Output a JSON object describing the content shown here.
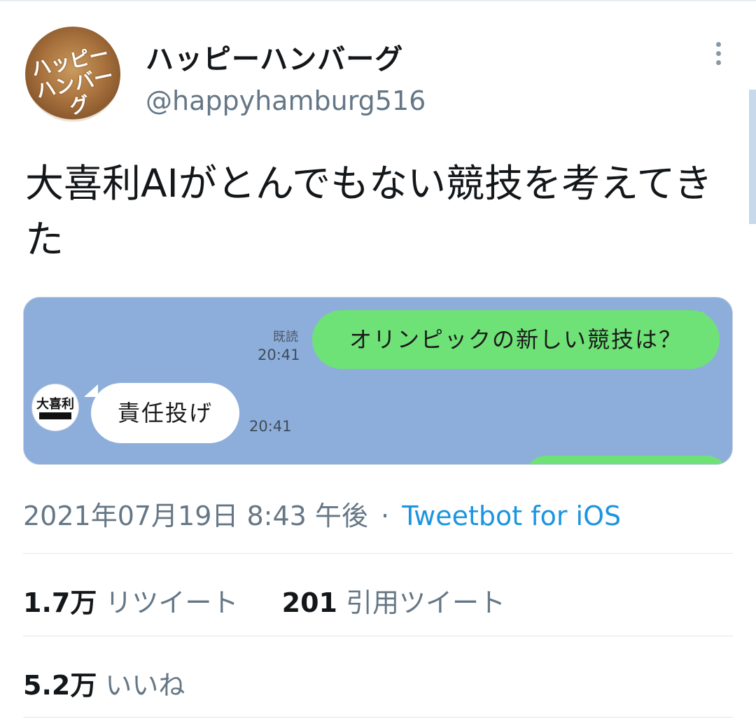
{
  "user": {
    "display_name": "ハッピーハンバーグ",
    "handle": "@happyhamburg516",
    "avatar_text": "ハッピーハンバーグ"
  },
  "tweet": {
    "text": "大喜利AIがとんでもない競技を考えてきた"
  },
  "media": {
    "read_label": "既読",
    "sent_time": "20:41",
    "sent_message": "オリンピックの新しい競技は？",
    "reply_message": "責任投げ",
    "reply_time": "20:41",
    "bot_avatar_text": "大喜利"
  },
  "meta": {
    "timestamp": "2021年07月19日 8:43 午後",
    "separator": "·",
    "source": "Tweetbot for iOS"
  },
  "stats": {
    "retweets_count": "1.7万",
    "retweets_label": "リツイート",
    "quotes_count": "201",
    "quotes_label": "引用ツイート",
    "likes_count": "5.2万",
    "likes_label": "いいね"
  },
  "colors": {
    "chat_background": "#8daedb",
    "bubble_green": "#6ee277",
    "link": "#1b95e0",
    "muted": "#657786"
  },
  "icons": [
    "more-vertical-icon"
  ]
}
